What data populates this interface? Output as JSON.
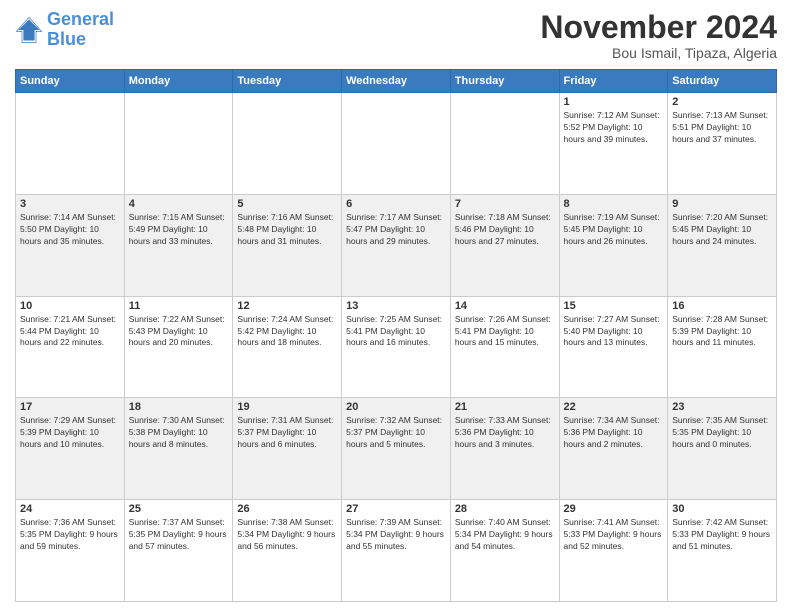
{
  "header": {
    "logo_line1": "General",
    "logo_line2": "Blue",
    "month_title": "November 2024",
    "subtitle": "Bou Ismail, Tipaza, Algeria"
  },
  "days_of_week": [
    "Sunday",
    "Monday",
    "Tuesday",
    "Wednesday",
    "Thursday",
    "Friday",
    "Saturday"
  ],
  "weeks": [
    [
      {
        "day": "",
        "info": ""
      },
      {
        "day": "",
        "info": ""
      },
      {
        "day": "",
        "info": ""
      },
      {
        "day": "",
        "info": ""
      },
      {
        "day": "",
        "info": ""
      },
      {
        "day": "1",
        "info": "Sunrise: 7:12 AM\nSunset: 5:52 PM\nDaylight: 10 hours and 39 minutes."
      },
      {
        "day": "2",
        "info": "Sunrise: 7:13 AM\nSunset: 5:51 PM\nDaylight: 10 hours and 37 minutes."
      }
    ],
    [
      {
        "day": "3",
        "info": "Sunrise: 7:14 AM\nSunset: 5:50 PM\nDaylight: 10 hours and 35 minutes."
      },
      {
        "day": "4",
        "info": "Sunrise: 7:15 AM\nSunset: 5:49 PM\nDaylight: 10 hours and 33 minutes."
      },
      {
        "day": "5",
        "info": "Sunrise: 7:16 AM\nSunset: 5:48 PM\nDaylight: 10 hours and 31 minutes."
      },
      {
        "day": "6",
        "info": "Sunrise: 7:17 AM\nSunset: 5:47 PM\nDaylight: 10 hours and 29 minutes."
      },
      {
        "day": "7",
        "info": "Sunrise: 7:18 AM\nSunset: 5:46 PM\nDaylight: 10 hours and 27 minutes."
      },
      {
        "day": "8",
        "info": "Sunrise: 7:19 AM\nSunset: 5:45 PM\nDaylight: 10 hours and 26 minutes."
      },
      {
        "day": "9",
        "info": "Sunrise: 7:20 AM\nSunset: 5:45 PM\nDaylight: 10 hours and 24 minutes."
      }
    ],
    [
      {
        "day": "10",
        "info": "Sunrise: 7:21 AM\nSunset: 5:44 PM\nDaylight: 10 hours and 22 minutes."
      },
      {
        "day": "11",
        "info": "Sunrise: 7:22 AM\nSunset: 5:43 PM\nDaylight: 10 hours and 20 minutes."
      },
      {
        "day": "12",
        "info": "Sunrise: 7:24 AM\nSunset: 5:42 PM\nDaylight: 10 hours and 18 minutes."
      },
      {
        "day": "13",
        "info": "Sunrise: 7:25 AM\nSunset: 5:41 PM\nDaylight: 10 hours and 16 minutes."
      },
      {
        "day": "14",
        "info": "Sunrise: 7:26 AM\nSunset: 5:41 PM\nDaylight: 10 hours and 15 minutes."
      },
      {
        "day": "15",
        "info": "Sunrise: 7:27 AM\nSunset: 5:40 PM\nDaylight: 10 hours and 13 minutes."
      },
      {
        "day": "16",
        "info": "Sunrise: 7:28 AM\nSunset: 5:39 PM\nDaylight: 10 hours and 11 minutes."
      }
    ],
    [
      {
        "day": "17",
        "info": "Sunrise: 7:29 AM\nSunset: 5:39 PM\nDaylight: 10 hours and 10 minutes."
      },
      {
        "day": "18",
        "info": "Sunrise: 7:30 AM\nSunset: 5:38 PM\nDaylight: 10 hours and 8 minutes."
      },
      {
        "day": "19",
        "info": "Sunrise: 7:31 AM\nSunset: 5:37 PM\nDaylight: 10 hours and 6 minutes."
      },
      {
        "day": "20",
        "info": "Sunrise: 7:32 AM\nSunset: 5:37 PM\nDaylight: 10 hours and 5 minutes."
      },
      {
        "day": "21",
        "info": "Sunrise: 7:33 AM\nSunset: 5:36 PM\nDaylight: 10 hours and 3 minutes."
      },
      {
        "day": "22",
        "info": "Sunrise: 7:34 AM\nSunset: 5:36 PM\nDaylight: 10 hours and 2 minutes."
      },
      {
        "day": "23",
        "info": "Sunrise: 7:35 AM\nSunset: 5:35 PM\nDaylight: 10 hours and 0 minutes."
      }
    ],
    [
      {
        "day": "24",
        "info": "Sunrise: 7:36 AM\nSunset: 5:35 PM\nDaylight: 9 hours and 59 minutes."
      },
      {
        "day": "25",
        "info": "Sunrise: 7:37 AM\nSunset: 5:35 PM\nDaylight: 9 hours and 57 minutes."
      },
      {
        "day": "26",
        "info": "Sunrise: 7:38 AM\nSunset: 5:34 PM\nDaylight: 9 hours and 56 minutes."
      },
      {
        "day": "27",
        "info": "Sunrise: 7:39 AM\nSunset: 5:34 PM\nDaylight: 9 hours and 55 minutes."
      },
      {
        "day": "28",
        "info": "Sunrise: 7:40 AM\nSunset: 5:34 PM\nDaylight: 9 hours and 54 minutes."
      },
      {
        "day": "29",
        "info": "Sunrise: 7:41 AM\nSunset: 5:33 PM\nDaylight: 9 hours and 52 minutes."
      },
      {
        "day": "30",
        "info": "Sunrise: 7:42 AM\nSunset: 5:33 PM\nDaylight: 9 hours and 51 minutes."
      }
    ]
  ]
}
